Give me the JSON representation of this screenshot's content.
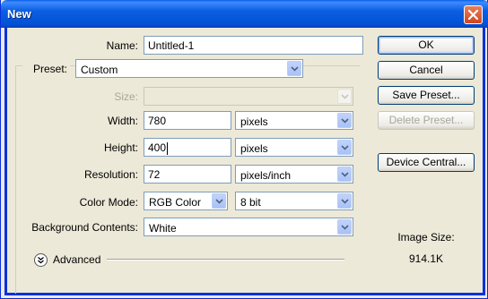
{
  "window": {
    "title": "New"
  },
  "labels": {
    "name": "Name:",
    "preset": "Preset:",
    "size": "Size:",
    "width": "Width:",
    "height": "Height:",
    "resolution": "Resolution:",
    "color_mode": "Color Mode:",
    "background": "Background Contents:",
    "advanced": "Advanced",
    "image_size": "Image Size:"
  },
  "fields": {
    "name": "Untitled-1",
    "preset": "Custom",
    "size": "",
    "width": "780",
    "width_unit": "pixels",
    "height": "400",
    "height_unit": "pixels",
    "resolution": "72",
    "resolution_unit": "pixels/inch",
    "color_mode": "RGB Color",
    "bit_depth": "8 bit",
    "background": "White"
  },
  "buttons": {
    "ok": "OK",
    "cancel": "Cancel",
    "save_preset": "Save Preset...",
    "delete_preset": "Delete Preset...",
    "device_central": "Device Central..."
  },
  "info": {
    "image_size_value": "914.1K"
  },
  "colors": {
    "titlebar": "#0b5ee0",
    "dialog_bg": "#ece9d8",
    "field_border": "#7f9db9",
    "disabled_text": "#a7a69b"
  }
}
